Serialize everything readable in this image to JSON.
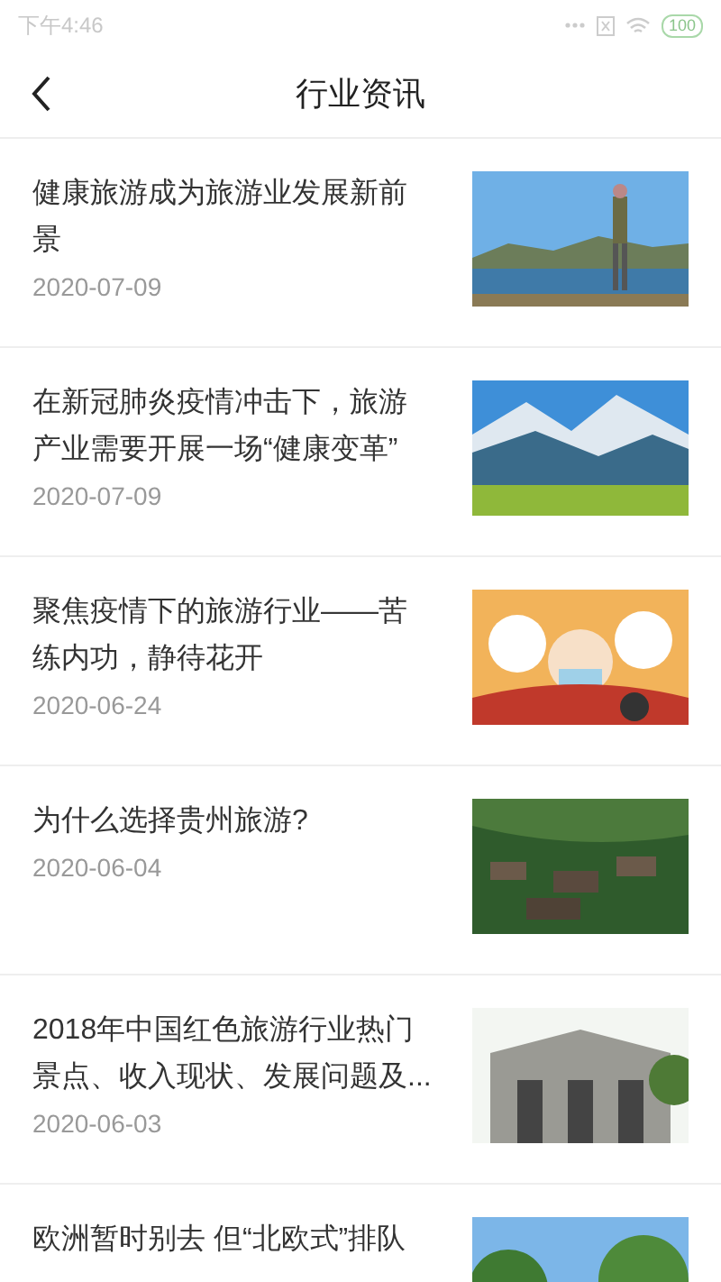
{
  "status_bar": {
    "time": "下午4:46",
    "battery": "100"
  },
  "header": {
    "title": "行业资讯"
  },
  "articles": [
    {
      "title": "健康旅游成为旅游业发展新前景",
      "date": "2020-07-09",
      "kind": "picture"
    },
    {
      "title": "在新冠肺炎疫情冲击下，旅游产业需要开展一场“健康变革”",
      "date": "2020-07-09",
      "kind": "picture"
    },
    {
      "title": "聚焦疫情下的旅游行业——苦练内功，静待花开",
      "date": "2020-06-24",
      "kind": "picture"
    },
    {
      "title": "为什么选择贵州旅游?",
      "date": "2020-06-04",
      "kind": "picture"
    },
    {
      "title": "2018年中国红色旅游行业热门景点、收入现状、发展问题及...",
      "date": "2020-06-03",
      "kind": "picture"
    },
    {
      "title": "欧洲暂时别去 但“北欧式”排队",
      "kind": "picture"
    }
  ]
}
